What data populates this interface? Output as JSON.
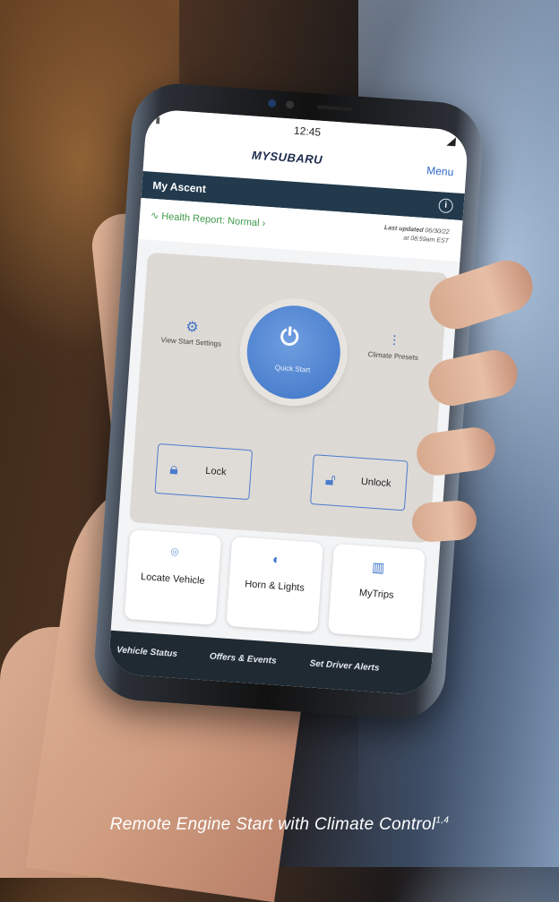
{
  "status": {
    "time": "12:45"
  },
  "app": {
    "logo": "MYSUBARU",
    "menu_label": "Menu",
    "vehicle_name": "My Ascent",
    "info_icon": "info-icon"
  },
  "health": {
    "label": "Health Report: Normal",
    "updated_label": "Last updated",
    "updated_date": "06/30/22",
    "updated_time": "at 08:59am EST"
  },
  "controls": {
    "quick_start": "Quick Start",
    "view_start_settings": "View Start Settings",
    "climate_presets": "Climate Presets",
    "lock": "Lock",
    "unlock": "Unlock"
  },
  "tiles": [
    {
      "label": "Locate Vehicle",
      "icon": "location-pin-icon"
    },
    {
      "label": "Horn & Lights",
      "icon": "headlight-icon"
    },
    {
      "label": "MyTrips",
      "icon": "map-icon"
    }
  ],
  "bottom_nav": [
    "Vehicle Status",
    "Offers & Events",
    "Set Driver Alerts"
  ],
  "caption": {
    "text": "Remote Engine Start with Climate Control",
    "superscript": "1,4"
  },
  "colors": {
    "accent_blue": "#3e74c7",
    "header_navy": "#223a4c",
    "health_green": "#3f9a4a"
  }
}
